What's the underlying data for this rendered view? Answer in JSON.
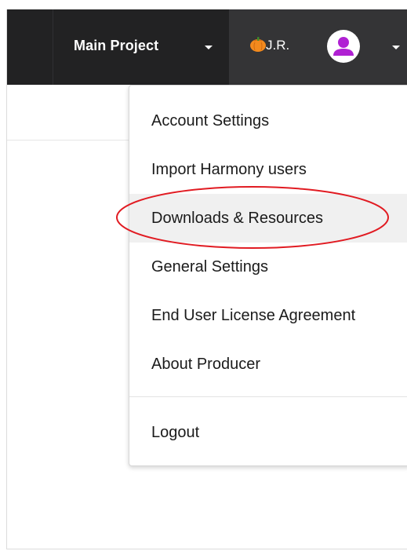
{
  "header": {
    "project_label": "Main Project",
    "user_initials": "J.R.",
    "icons": {
      "project_caret": "chevron-down",
      "user_caret": "chevron-down",
      "status_emoji": "pumpkin",
      "avatar": "user-silhouette"
    }
  },
  "user_menu": {
    "items": [
      {
        "label": "Account Settings"
      },
      {
        "label": "Import Harmony users"
      },
      {
        "label": "Downloads & Resources",
        "highlighted": true
      },
      {
        "label": "General Settings"
      },
      {
        "label": "End User License Agreement"
      },
      {
        "label": "About Producer"
      },
      {
        "label": "Logout"
      }
    ]
  },
  "colors": {
    "topbar": "#222223",
    "user_menu_bg": "#343436",
    "avatar_fg": "#b021d3",
    "annotation": "#e11b22",
    "highlight": "#f0f0f0"
  }
}
